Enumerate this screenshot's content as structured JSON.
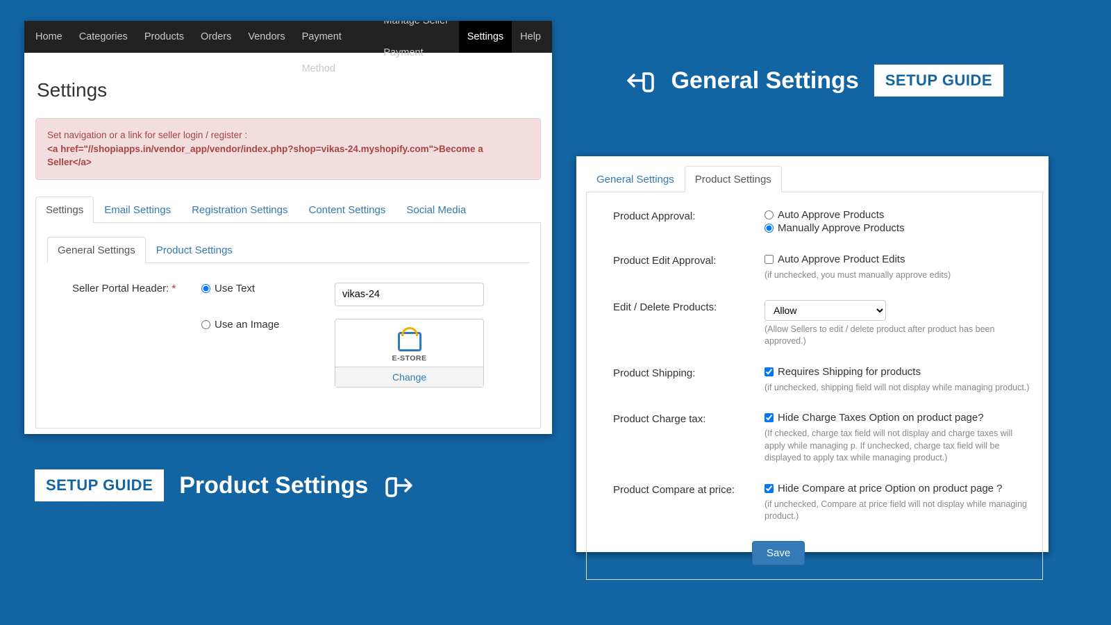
{
  "topnav": {
    "items": [
      {
        "label": "Home"
      },
      {
        "label": "Categories"
      },
      {
        "label": "Products"
      },
      {
        "label": "Orders"
      },
      {
        "label": "Vendors"
      },
      {
        "label": "Seller Payment Method"
      },
      {
        "label": "Manage Seller Payment"
      },
      {
        "label": "Settings"
      },
      {
        "label": "Help"
      }
    ],
    "active_index": 7
  },
  "page": {
    "title": "Settings"
  },
  "alert": {
    "line1": "Set navigation or a link for seller login / register :",
    "line2": "<a href=\"//shopiapps.in/vendor_app/vendor/index.php?shop=vikas-24.myshopify.com\">Become a Seller</a>"
  },
  "tabs_outer": {
    "items": [
      "Settings",
      "Email Settings",
      "Registration Settings",
      "Content Settings",
      "Social Media"
    ],
    "active_index": 0
  },
  "tabs_inner_left": {
    "items": [
      "General Settings",
      "Product Settings"
    ],
    "active_index": 0
  },
  "general_form": {
    "seller_portal_label": "Seller Portal Header:",
    "use_text_label": "Use Text",
    "use_image_label": "Use an Image",
    "header_value": "vikas-24",
    "logo_caption": "E-STORE",
    "change_label": "Change"
  },
  "tabs_right": {
    "items": [
      "General Settings",
      "Product Settings"
    ],
    "active_index": 1
  },
  "product_settings": {
    "rows": {
      "approval": {
        "label": "Product Approval:",
        "auto_label": "Auto Approve Products",
        "manual_label": "Manually Approve Products",
        "selected": "manual"
      },
      "edit_approval": {
        "label": "Product Edit Approval:",
        "check_label": "Auto Approve Product Edits",
        "checked": false,
        "hint": "(if unchecked, you must manually approve edits)"
      },
      "edit_delete": {
        "label": "Edit / Delete Products:",
        "options": [
          "Allow"
        ],
        "selected": "Allow",
        "hint": "(Allow Sellers to edit / delete product after product has been approved.)"
      },
      "shipping": {
        "label": "Product Shipping:",
        "check_label": "Requires Shipping for products",
        "checked": true,
        "hint": "(if unchecked, shipping field will not display while managing product.)"
      },
      "charge_tax": {
        "label": "Product Charge tax:",
        "check_label": "Hide Charge Taxes Option on product page?",
        "checked": true,
        "hint": "(If checked, charge tax field will not display and charge taxes will apply while managing p. If unchecked, charge tax field will be displayed to apply tax while managing product.)"
      },
      "compare_price": {
        "label": "Product Compare at price:",
        "check_label": "Hide Compare at price Option on product page ?",
        "checked": true,
        "hint": "(if unchecked, Compare at price field will not display while managing product.)"
      }
    },
    "save_label": "Save"
  },
  "callouts": {
    "general": {
      "title": "General Settings",
      "badge": "SETUP GUIDE"
    },
    "product": {
      "title": "Product Settings",
      "badge": "SETUP GUIDE"
    }
  }
}
